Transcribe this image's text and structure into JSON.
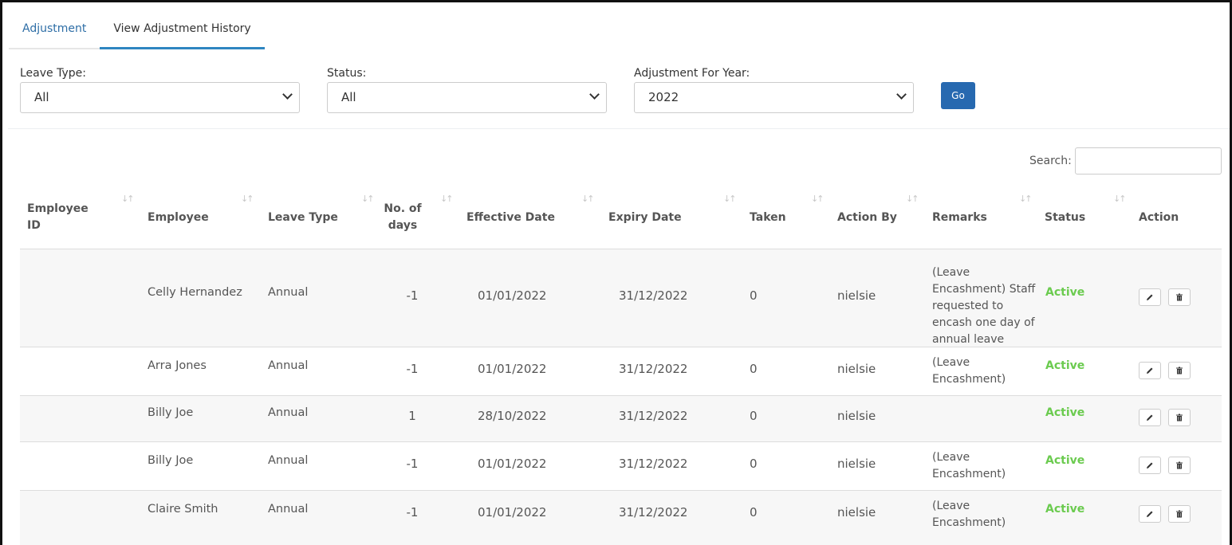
{
  "tabs": [
    {
      "label": "Adjustment"
    },
    {
      "label": "View Adjustment History"
    }
  ],
  "filters": {
    "leave_type": {
      "label": "Leave Type:",
      "value": "All"
    },
    "status": {
      "label": "Status:",
      "value": "All"
    },
    "year": {
      "label": "Adjustment For Year:",
      "value": "2022"
    },
    "go_label": "Go"
  },
  "search": {
    "label": "Search:",
    "value": ""
  },
  "table": {
    "headers": {
      "employee_id": "Employee ID",
      "employee": "Employee",
      "leave_type": "Leave Type",
      "days": "No. of days",
      "effective": "Effective Date",
      "expiry": "Expiry Date",
      "taken": "Taken",
      "action_by": "Action By",
      "remarks": "Remarks",
      "status": "Status",
      "action": "Action"
    },
    "rows": [
      {
        "employee_id": "",
        "employee": "Celly Hernandez",
        "leave_type": "Annual",
        "days": "-1",
        "effective": "01/01/2022",
        "expiry": "31/12/2022",
        "taken": "0",
        "action_by": "nielsie",
        "remarks": "(Leave Encashment) Staff requested to encash one day of annual leave",
        "status": "Active"
      },
      {
        "employee_id": "",
        "employee": "Arra Jones",
        "leave_type": "Annual",
        "days": "-1",
        "effective": "01/01/2022",
        "expiry": "31/12/2022",
        "taken": "0",
        "action_by": "nielsie",
        "remarks": "(Leave Encashment)",
        "status": "Active"
      },
      {
        "employee_id": "",
        "employee": "Billy Joe",
        "leave_type": "Annual",
        "days": "1",
        "effective": "28/10/2022",
        "expiry": "31/12/2022",
        "taken": "0",
        "action_by": "nielsie",
        "remarks": "",
        "status": "Active"
      },
      {
        "employee_id": "",
        "employee": "Billy Joe",
        "leave_type": "Annual",
        "days": "-1",
        "effective": "01/01/2022",
        "expiry": "31/12/2022",
        "taken": "0",
        "action_by": "nielsie",
        "remarks": "(Leave Encashment)",
        "status": "Active"
      },
      {
        "employee_id": "",
        "employee": "Claire Smith",
        "leave_type": "Annual",
        "days": "-1",
        "effective": "01/01/2022",
        "expiry": "31/12/2022",
        "taken": "0",
        "action_by": "nielsie",
        "remarks": "(Leave Encashment)",
        "status": "Active"
      }
    ]
  },
  "icons": {
    "sort": "sort-icon",
    "edit": "pencil-icon",
    "delete": "trash-icon"
  },
  "colors": {
    "accent": "#2e86c1",
    "button": "#2769b0",
    "status_active": "#6bcb4f"
  }
}
